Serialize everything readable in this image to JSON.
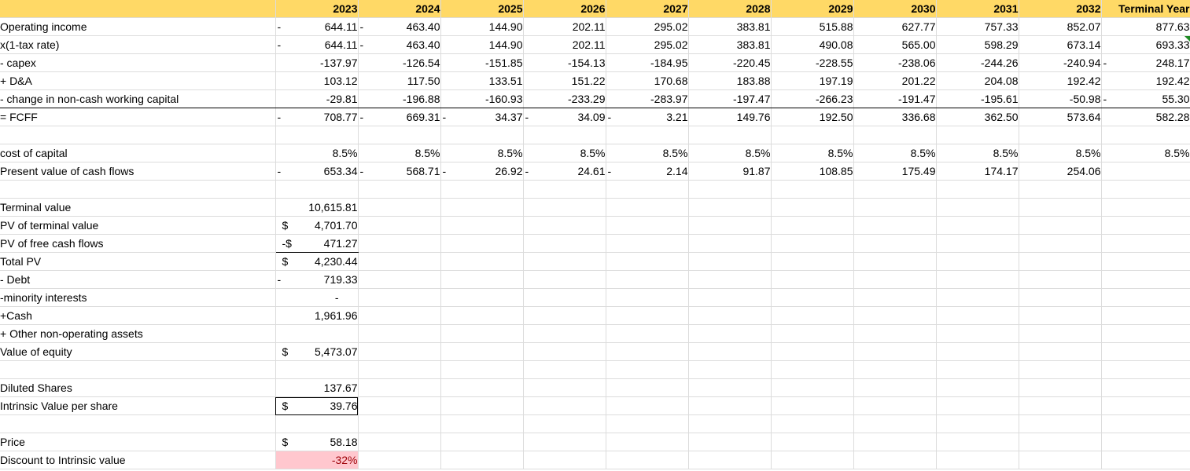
{
  "years": [
    "2023",
    "2024",
    "2025",
    "2026",
    "2027",
    "2028",
    "2029",
    "2030",
    "2031",
    "2032"
  ],
  "terminal_header": "Terminal Year",
  "dash": "-",
  "rows": {
    "operating_income": {
      "label": "Operating income",
      "values": [
        "644.11",
        "463.40",
        "144.90",
        "202.11",
        "295.02",
        "383.81",
        "515.88",
        "627.77",
        "757.33",
        "852.07",
        "877.63"
      ]
    },
    "after_tax": {
      "label": "x(1-tax rate)",
      "values": [
        "644.11",
        "463.40",
        "144.90",
        "202.11",
        "295.02",
        "383.81",
        "490.08",
        "565.00",
        "598.29",
        "673.14",
        "693.33"
      ]
    },
    "capex": {
      "label": "- capex",
      "values": [
        "-137.97",
        "-126.54",
        "-151.85",
        "-154.13",
        "-184.95",
        "-220.45",
        "-228.55",
        "-238.06",
        "-244.26",
        "-240.94",
        "248.17"
      ]
    },
    "da": {
      "label": "+ D&A",
      "values": [
        "103.12",
        "117.50",
        "133.51",
        "151.22",
        "170.68",
        "183.88",
        "197.19",
        "201.22",
        "204.08",
        "192.42",
        "192.42"
      ]
    },
    "nwc": {
      "label": "- change in non-cash working capital",
      "values": [
        "-29.81",
        "-196.88",
        "-160.93",
        "-233.29",
        "-283.97",
        "-197.47",
        "-266.23",
        "-191.47",
        "-195.61",
        "-50.98",
        "55.30"
      ]
    },
    "fcff": {
      "label": "= FCFF",
      "values": [
        "708.77",
        "669.31",
        "34.37",
        "34.09",
        "3.21",
        "149.76",
        "192.50",
        "336.68",
        "362.50",
        "573.64",
        "582.28"
      ]
    },
    "cost_of_capital": {
      "label": "cost of capital",
      "values": [
        "8.5%",
        "8.5%",
        "8.5%",
        "8.5%",
        "8.5%",
        "8.5%",
        "8.5%",
        "8.5%",
        "8.5%",
        "8.5%",
        "8.5%"
      ]
    },
    "pv_cash_flows": {
      "label": "Present value of cash flows",
      "values": [
        "653.34",
        "568.71",
        "26.92",
        "24.61",
        "2.14",
        "91.87",
        "108.85",
        "175.49",
        "174.17",
        "254.06"
      ]
    }
  },
  "summary": {
    "terminal_value": {
      "label": "Terminal value",
      "value": "10,615.81"
    },
    "pv_terminal": {
      "label": "PV of terminal value",
      "currency": "$",
      "value": "4,701.70"
    },
    "pv_fcf": {
      "label": "PV of free cash flows",
      "currency": "-$",
      "value": "471.27"
    },
    "total_pv": {
      "label": "Total PV",
      "currency": "$",
      "value": "4,230.44"
    },
    "debt": {
      "label": "- Debt",
      "value": "719.33"
    },
    "minority": {
      "label": "-minority interests",
      "value": "-"
    },
    "cash": {
      "label": "+Cash",
      "value": "1,961.96"
    },
    "other_assets": {
      "label": "+ Other non-operating assets",
      "value": ""
    },
    "equity": {
      "label": "Value of equity",
      "currency": "$",
      "value": "5,473.07"
    },
    "shares": {
      "label": "Diluted Shares",
      "value": "137.67"
    },
    "intrinsic": {
      "label": "Intrinsic Value per share",
      "currency": "$",
      "value": "39.76"
    },
    "price": {
      "label": "Price",
      "currency": "$",
      "value": "58.18"
    },
    "discount": {
      "label": "Discount to Intrinsic value",
      "value": "-32%"
    }
  },
  "colors": {
    "header_fill": "#ffd966",
    "negative_fill": "#ffc7ce",
    "negative_text": "#9c0006",
    "comment_flag": "#1f8b24"
  }
}
